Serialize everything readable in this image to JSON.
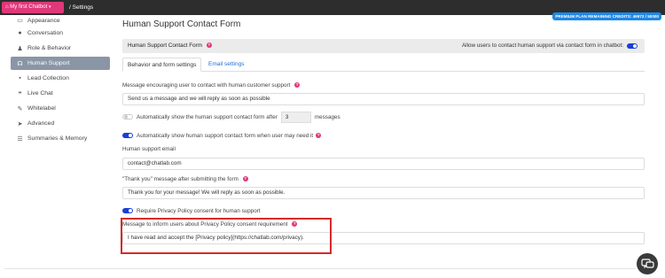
{
  "topbar": {
    "chatbot_label": "My first Chatbot",
    "breadcrumb": "/ Settings",
    "plan_badge": "PREMIUM PLAN REMAINING CREDITS: 49972 / 50000"
  },
  "sidebar": {
    "items": [
      {
        "label": "Appearance",
        "icon": "monitor-icon"
      },
      {
        "label": "Conversation",
        "icon": "chat-bubble-icon"
      },
      {
        "label": "Role & Behavior",
        "icon": "user-icon"
      },
      {
        "label": "Human Support",
        "icon": "headset-icon",
        "active": true
      },
      {
        "label": "Lead Collection",
        "icon": "address-book-icon"
      },
      {
        "label": "Live Chat",
        "icon": "comments-icon"
      },
      {
        "label": "Whitelabel",
        "icon": "pen-icon"
      },
      {
        "label": "Advanced",
        "icon": "rocket-icon"
      },
      {
        "label": "Summaries & Memory",
        "icon": "list-icon"
      }
    ]
  },
  "main": {
    "title": "Human Support Contact Form",
    "panel_title": "Human Support Contact Form",
    "allow_label": "Allow users to contact human support via contact form in chatbot:",
    "tabs": [
      "Behavior and form settings",
      "Email settings"
    ],
    "encourage_label": "Message encouraging user to contact with human customer support",
    "encourage_value": "Send us a message and we will reply as soon as possible",
    "auto_show_prefix": "Automatically show the human support contact form after",
    "auto_show_count": "3",
    "auto_show_suffix": "messages",
    "auto_need_label": "Automatically show human support contact form when user may need it",
    "email_label": "Human support email",
    "email_value": "contact@chatlab.com",
    "thanks_label": "\"Thank you\" message after submitting the form",
    "thanks_value": "Thank you for your message! We will reply as soon as possible.",
    "privacy_toggle_label": "Require Privacy Policy consent for human support",
    "privacy_msg_label": "Message to inform users about Privacy Policy consent requirement",
    "privacy_msg_value": "I have read and accept the [Privacy policy](https://chatlab.com/privacy)."
  },
  "colors": {
    "accent": "#e0387a",
    "toggle_on": "#1a3ed6",
    "highlight": "#d42a2a",
    "badge": "#1e88e5"
  }
}
